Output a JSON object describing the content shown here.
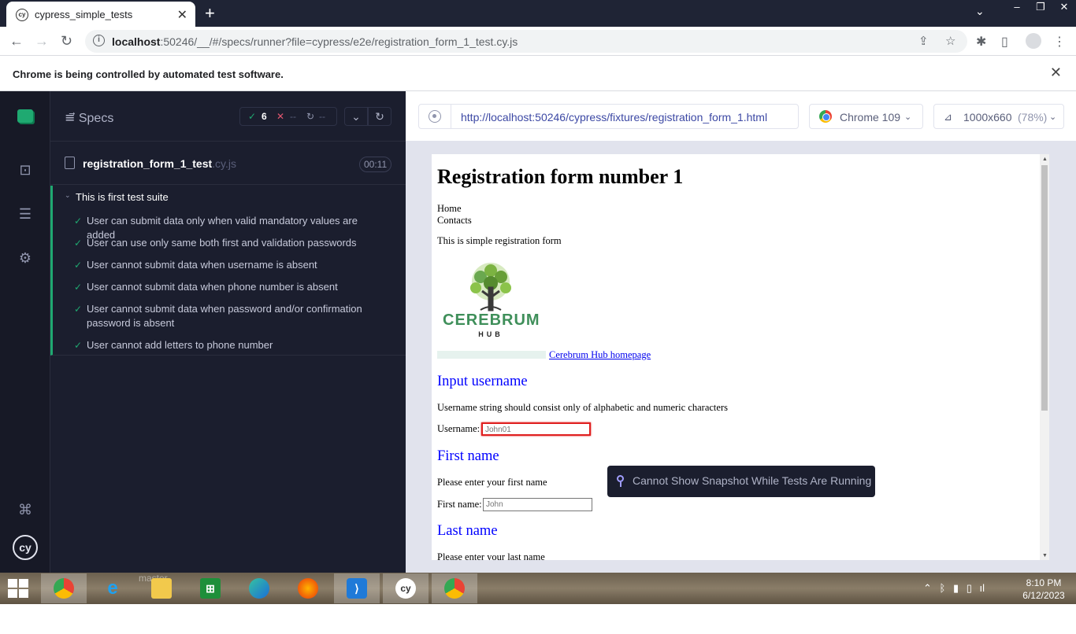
{
  "browser": {
    "tab_title": "cypress_simple_tests",
    "tab_favicon_text": "cy",
    "url_host": "localhost",
    "url_rest": ":50246/__/#/specs/runner?file=cypress/e2e/registration_form_1_test.cy.js",
    "infobar_message": "Chrome is being controlled by automated test software."
  },
  "reporter": {
    "specs_label": "Specs",
    "passed_count": "6",
    "failed_count": "--",
    "pending_count": "--",
    "spec_name": "registration_form_1_test",
    "spec_ext": ".cy.js",
    "duration": "00:11",
    "suite_title": "This is first test suite",
    "tests": [
      {
        "title": "User can submit data only when valid mandatory values are added"
      },
      {
        "title": "User can use only same both first and validation passwords"
      },
      {
        "title": "User cannot submit data when username is absent"
      },
      {
        "title": "User cannot submit data when phone number is absent"
      },
      {
        "title": "User cannot submit data when password and/or confirmation password is absent"
      },
      {
        "title": "User cannot add letters to phone number"
      }
    ]
  },
  "aut_header": {
    "url": "http://localhost:50246/cypress/fixtures/registration_form_1.html",
    "browser_label": "Chrome 109",
    "viewport_label": "1000x660",
    "viewport_zoom": "(78%)"
  },
  "aut_page": {
    "heading": "Registration form number 1",
    "nav_home": "Home",
    "nav_contacts": "Contacts",
    "intro": "This is simple registration form",
    "logo_text": "CEREBRUM",
    "logo_subtext": "HUB",
    "homepage_link": "Cerebrum Hub homepage",
    "section_username": "Input username",
    "username_hint": "Username string should consist only of alphabetic and numeric characters",
    "username_label": "Username:",
    "username_placeholder": "John01",
    "section_first": "First name",
    "first_hint": "Please enter your first name",
    "first_label": "First name:",
    "first_placeholder": "John",
    "section_last": "Last name",
    "last_hint": "Please enter your last name"
  },
  "toast": "Cannot Show Snapshot While Tests Are Running",
  "taskbar": {
    "time": "8:10 PM",
    "date": "6/12/2023",
    "faded_label": "master"
  },
  "colors": {
    "pass": "#1fa971",
    "fail": "#e45770",
    "reporter_bg": "#1b1e2e",
    "link_blue": "#0000ff",
    "invalid_border": "#e02020"
  }
}
